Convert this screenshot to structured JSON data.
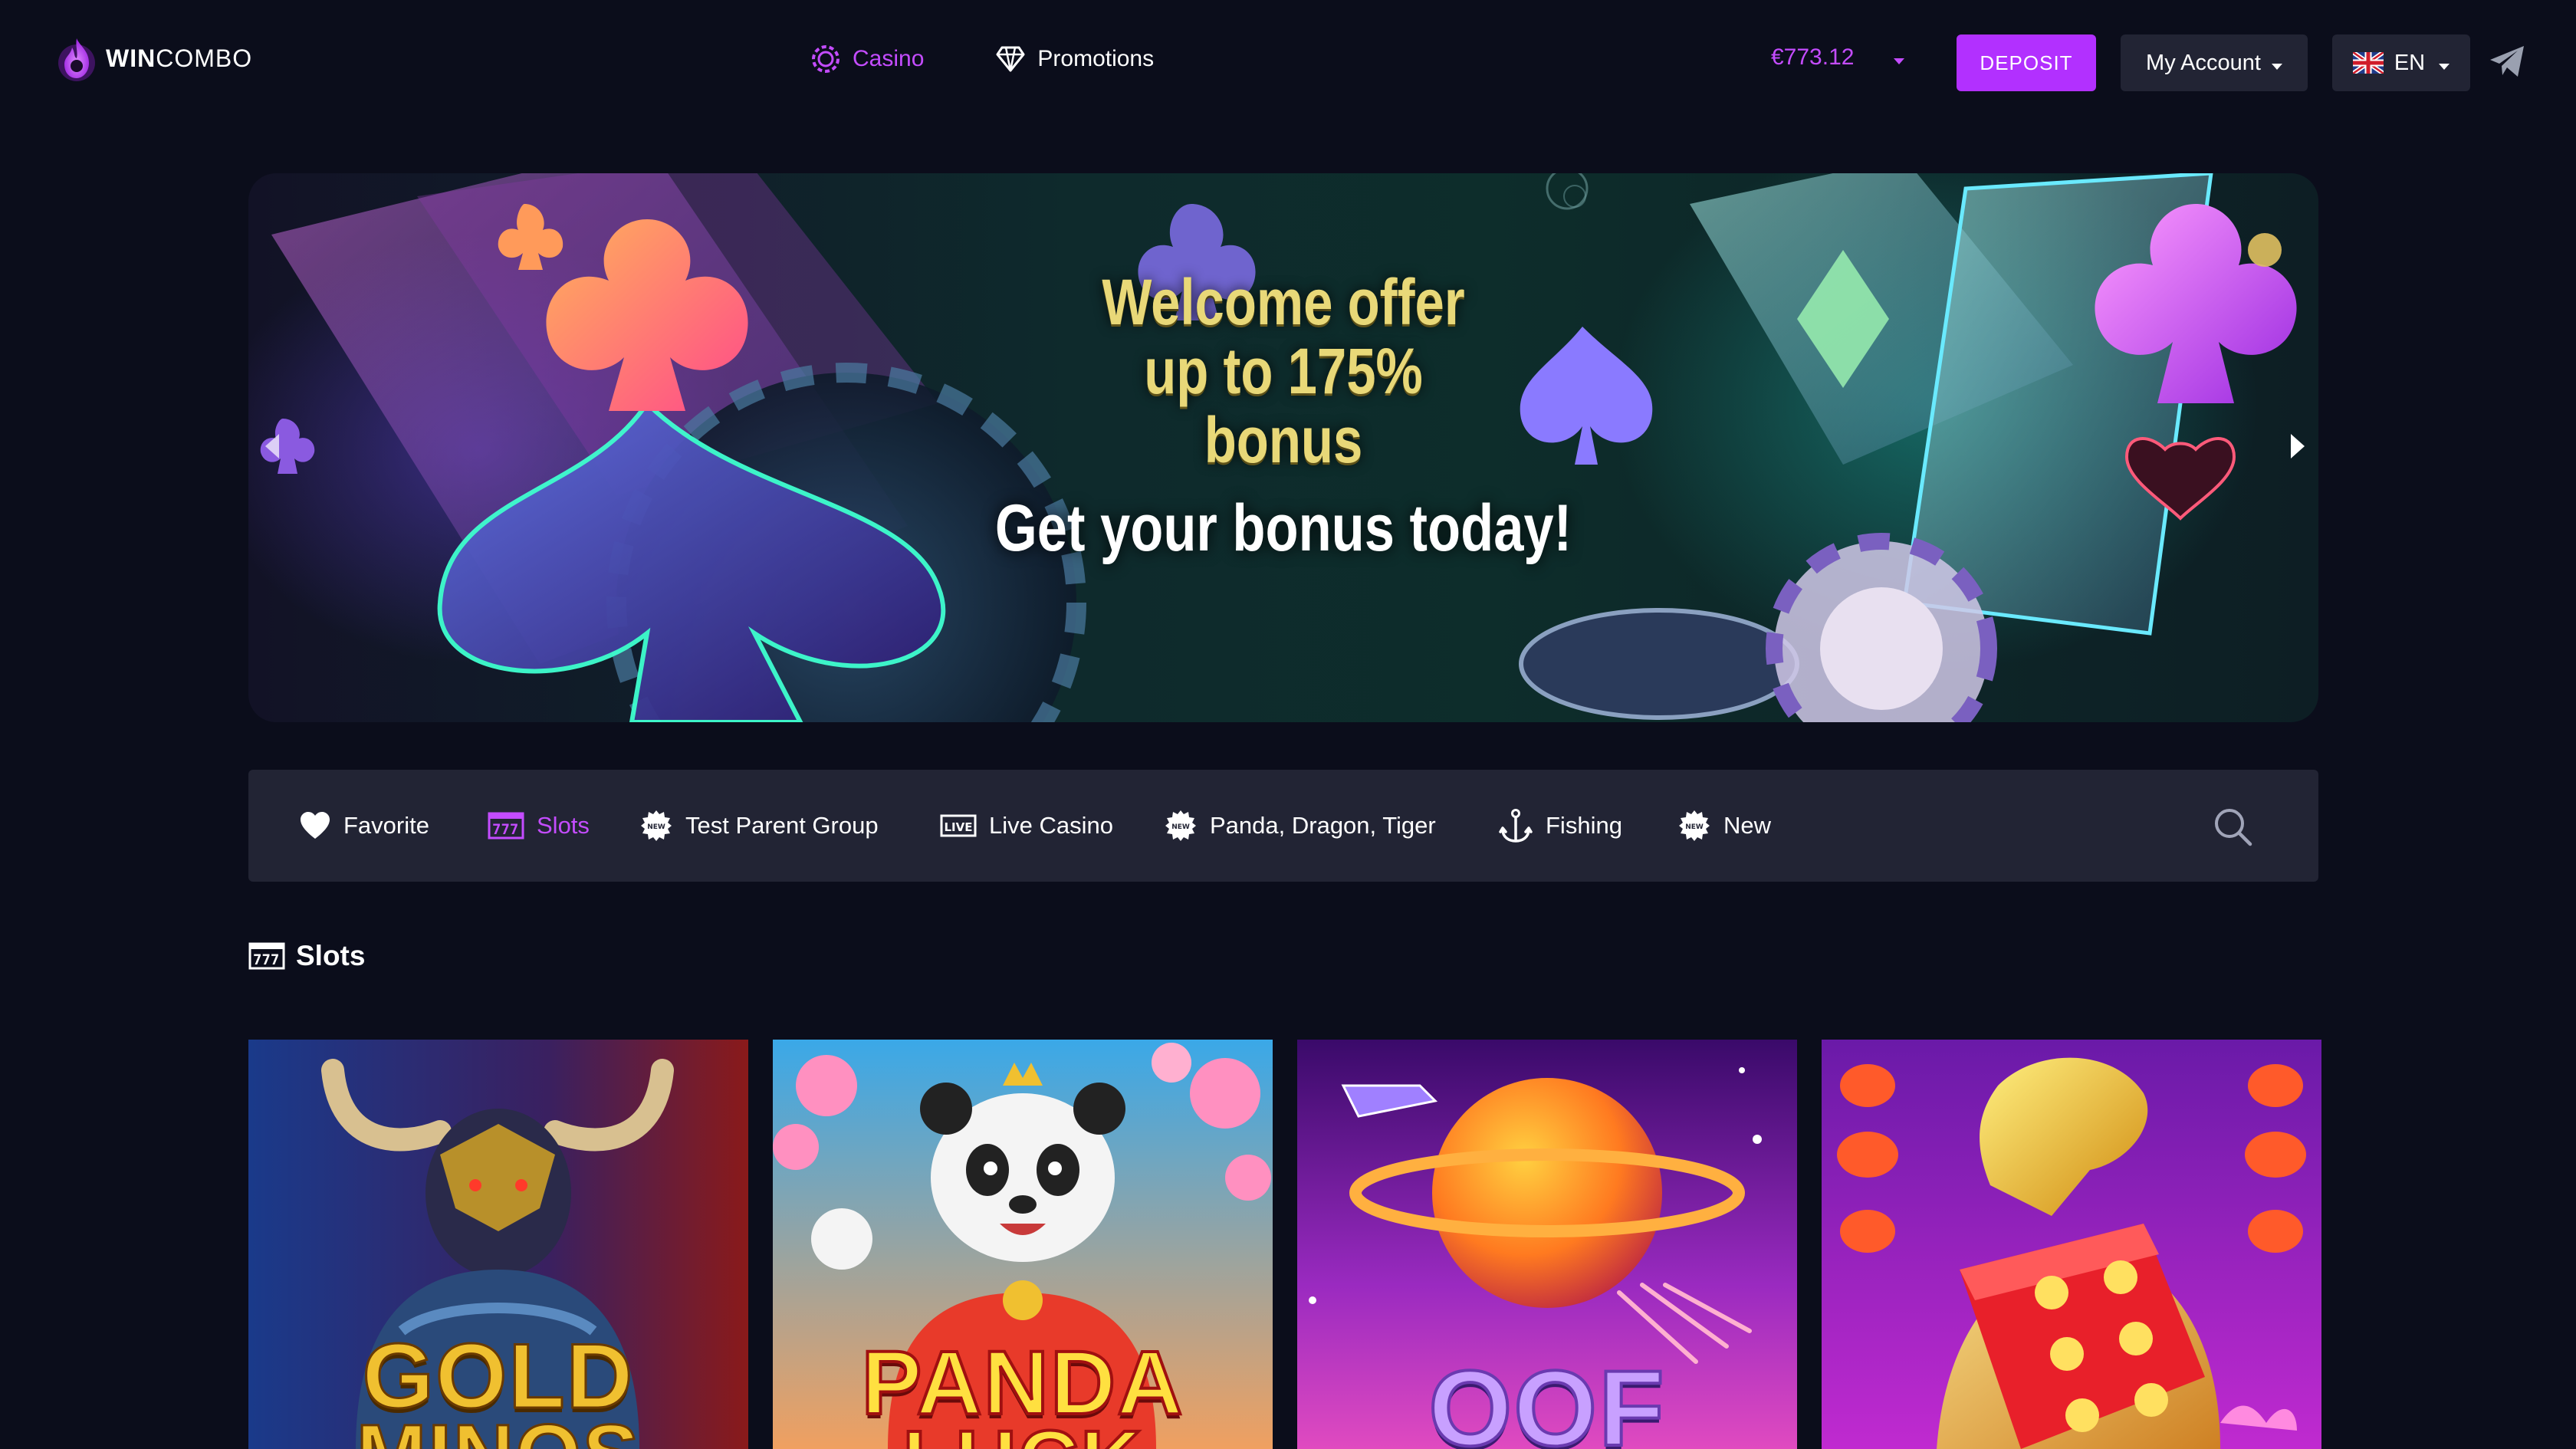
{
  "brand": {
    "name_bold": "WIN",
    "name_light": "COMBO"
  },
  "nav": {
    "items": [
      {
        "label": "Casino",
        "icon": "casino-chip-icon",
        "active": true
      },
      {
        "label": "Promotions",
        "icon": "diamond-icon",
        "active": false
      }
    ]
  },
  "account": {
    "balance": "€773.12",
    "deposit_label": "DEPOSIT",
    "account_label": "My Account",
    "language_label": "EN",
    "language_flag": "uk-flag-icon"
  },
  "banner": {
    "line1": "Welcome offer",
    "line2": "up to 175%",
    "line3": "bonus",
    "line4": "Get your bonus today!"
  },
  "categories": [
    {
      "label": "Favorite",
      "icon": "heart-icon",
      "active": false
    },
    {
      "label": "Slots",
      "icon": "slots-777-icon",
      "active": true
    },
    {
      "label": "Test Parent Group",
      "icon": "new-badge-icon",
      "active": false
    },
    {
      "label": "Live Casino",
      "icon": "live-badge-icon",
      "active": false
    },
    {
      "label": "Panda, Dragon, Tiger",
      "icon": "new-badge-icon",
      "active": false
    },
    {
      "label": "Fishing",
      "icon": "anchor-icon",
      "active": false
    },
    {
      "label": "New",
      "icon": "new-badge-icon",
      "active": false
    }
  ],
  "section": {
    "title": "Slots"
  },
  "games": [
    {
      "title": "GOLD",
      "subtitle": "MINOS",
      "theme": "minotaur"
    },
    {
      "title": "PANDA",
      "subtitle": "LUCK",
      "theme": "panda"
    },
    {
      "title": "OOF",
      "subtitle": "",
      "theme": "space"
    },
    {
      "title": "",
      "subtitle": "",
      "theme": "dragon-dice"
    }
  ],
  "colors": {
    "accent": "#c44cff",
    "deposit": "#b230ff",
    "background": "#0b0d1b",
    "panel": "#222434"
  }
}
